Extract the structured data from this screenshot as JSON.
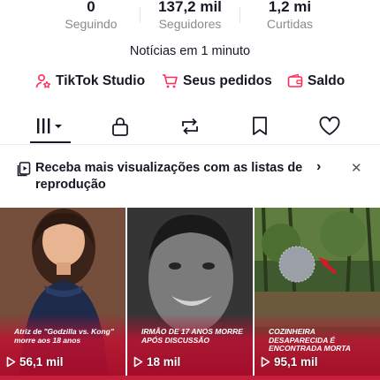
{
  "stats": [
    {
      "value": "0",
      "label": "Seguindo"
    },
    {
      "value": "137,2 mil",
      "label": "Seguidores"
    },
    {
      "value": "1,2 mi",
      "label": "Curtidas"
    }
  ],
  "bio": "Notícias em 1 minuto",
  "links": {
    "studio": {
      "label": "TikTok Studio",
      "icon": "person-star-icon"
    },
    "orders": {
      "label": "Seus pedidos",
      "icon": "cart-icon"
    },
    "balance": {
      "label": "Saldo",
      "icon": "wallet-icon"
    }
  },
  "tabs": [
    {
      "name": "videos",
      "icon": "grid-icon",
      "active": true
    },
    {
      "name": "private",
      "icon": "lock-icon",
      "active": false
    },
    {
      "name": "reposts",
      "icon": "repost-icon",
      "active": false
    },
    {
      "name": "favorites",
      "icon": "bookmark-icon",
      "active": false
    },
    {
      "name": "liked",
      "icon": "heart-icon",
      "active": false
    }
  ],
  "banner": {
    "text": "Receba mais visualizações com as listas de reprodução"
  },
  "videos": [
    {
      "headline": "Atriz de \"Godzilla vs. Kong\" morre aos 18 anos",
      "views": "56,1 mil"
    },
    {
      "headline": "IRMÃO DE 17 ANOS MORRE APÓS DISCUSSÃO",
      "views": "18 mil"
    },
    {
      "headline": "COZINHEIRA DESAPARECIDA É ENCONTRADA MORTA",
      "views": "95,1 mil"
    }
  ],
  "colors": {
    "accent": "#fe2c55",
    "text": "#161823",
    "muted": "#8a8b91",
    "thumb_red": "#be1232"
  }
}
